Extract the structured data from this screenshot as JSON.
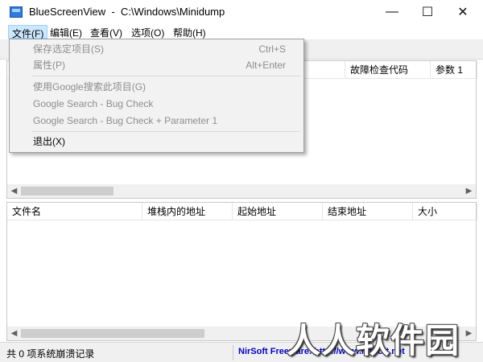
{
  "window": {
    "title": "BlueScreenView  -  C:\\Windows\\Minidump",
    "minimize_glyph": "—",
    "maximize_glyph": "☐",
    "close_glyph": "✕"
  },
  "menubar": {
    "file": "文件(F)",
    "edit": "编辑(E)",
    "view": "查看(V)",
    "options": "选项(O)",
    "help": "帮助(H)"
  },
  "file_menu": {
    "save_selected": {
      "label": "保存选定项目(S)",
      "shortcut": "Ctrl+S"
    },
    "properties": {
      "label": "属性(P)",
      "shortcut": "Alt+Enter"
    },
    "google_search_item": {
      "label": "使用Google搜索此项目(G)"
    },
    "google_bug_check": {
      "label": "Google Search - Bug Check"
    },
    "google_bug_check_param1": {
      "label": "Google Search - Bug Check + Parameter 1"
    },
    "exit": {
      "label": "退出(X)"
    }
  },
  "top_table": {
    "columns": [
      "故障检查代码",
      "参数 1"
    ]
  },
  "bottom_table": {
    "columns": [
      "文件名",
      "堆栈内的地址",
      "起始地址",
      "结束地址",
      "大小"
    ]
  },
  "status": {
    "count_text": "共 0 项系统崩溃记录",
    "link_text": "NirSoft Freeware.  http://www.nirsoft.net"
  },
  "watermark": "人人软件园",
  "colors": {
    "menu_active_bg": "#cce8ff",
    "link": "#0000cc"
  }
}
